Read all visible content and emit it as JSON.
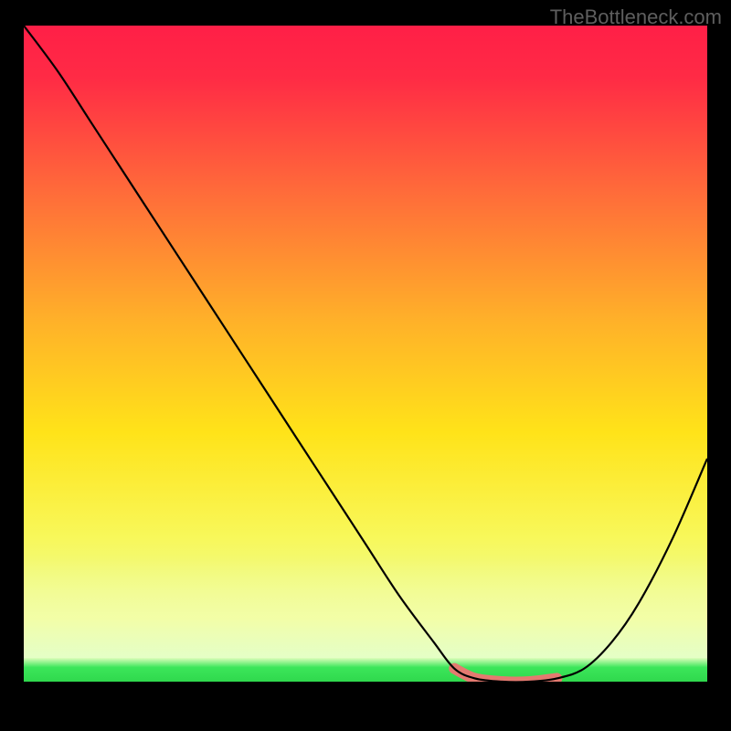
{
  "watermark": "TheBottleneck.com",
  "chart_data": {
    "type": "line",
    "title": "",
    "xlabel": "",
    "ylabel": "",
    "xlim": [
      0,
      100
    ],
    "ylim": [
      0,
      100
    ],
    "grid": false,
    "legend": false,
    "series": [
      {
        "name": "bottleneck-curve",
        "x": [
          0,
          5,
          10,
          15,
          20,
          25,
          30,
          35,
          40,
          45,
          50,
          55,
          60,
          63,
          66,
          70,
          74,
          78,
          82,
          86,
          90,
          95,
          100
        ],
        "y": [
          100,
          93,
          85,
          77,
          69,
          61,
          53,
          45,
          37,
          29,
          21,
          13,
          6,
          2,
          0.5,
          0,
          0,
          0.5,
          2,
          6,
          12,
          22,
          34
        ],
        "color": "#000000"
      }
    ],
    "highlight": {
      "name": "optimal-range",
      "x": [
        63,
        66,
        70,
        74,
        78
      ],
      "y": [
        2,
        0.5,
        0,
        0,
        0.5
      ],
      "color": "#e47a70"
    },
    "background_gradient": {
      "top": "#ff1f47",
      "mid": "#ffd400",
      "bottom": "#3ce65a"
    }
  }
}
